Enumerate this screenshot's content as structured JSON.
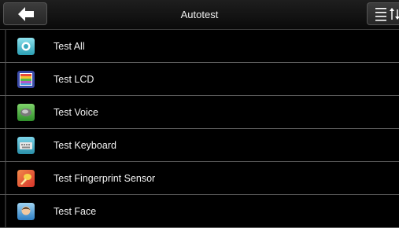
{
  "header": {
    "title": "Autotest",
    "back_icon": "back-arrow-icon",
    "menu_icon": "sort-menu-icon"
  },
  "items": [
    {
      "label": "Test All",
      "icon": "test-all-icon"
    },
    {
      "label": "Test LCD",
      "icon": "lcd-icon"
    },
    {
      "label": "Test Voice",
      "icon": "voice-icon"
    },
    {
      "label": "Test Keyboard",
      "icon": "keyboard-icon"
    },
    {
      "label": "Test Fingerprint Sensor",
      "icon": "fingerprint-sensor-icon"
    },
    {
      "label": "Test Face",
      "icon": "face-icon"
    }
  ],
  "colors": {
    "background": "#000000",
    "text": "#f2f2f2",
    "divider": "#5a5a5a"
  }
}
